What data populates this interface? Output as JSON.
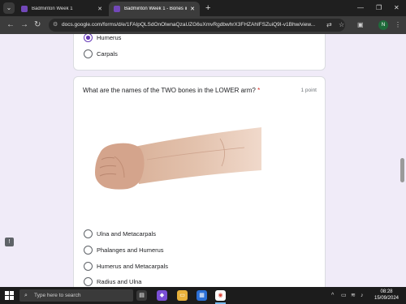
{
  "browser": {
    "tabs": [
      {
        "title": "Badminton Week 1",
        "close": "✕"
      },
      {
        "title": "Badminton Week 1 - Bones in t",
        "close": "✕"
      }
    ],
    "new_tab": "+",
    "window_controls": {
      "minimize": "—",
      "maximize": "❐",
      "close": "✕"
    },
    "url": "docs.google.com/forms/d/e/1FAIpQLSdOnOlwnaQzaUZG6uXmvRgdbwhrX3FHZAhIFSZuiQ9I-v1Bhw/view...",
    "profile_initial": "N"
  },
  "previous_question": {
    "options": [
      {
        "label": "Humerus",
        "checked": true
      },
      {
        "label": "Carpals",
        "checked": false
      }
    ]
  },
  "question": {
    "title": "What are the names of the TWO bones in the LOWER arm?",
    "required_mark": "*",
    "points": "1 point",
    "options": [
      {
        "label": "Ulna and Metacarpals"
      },
      {
        "label": "Phalanges and Humerus"
      },
      {
        "label": "Humerus and Metacarpals"
      },
      {
        "label": "Radius and Ulna"
      }
    ]
  },
  "taskbar": {
    "search_placeholder": "Type here to search",
    "time": "08:28",
    "date": "15/09/2024"
  },
  "colors": {
    "accent": "#673ab7",
    "page_bg": "#f0ebf8",
    "required": "#d93025"
  }
}
